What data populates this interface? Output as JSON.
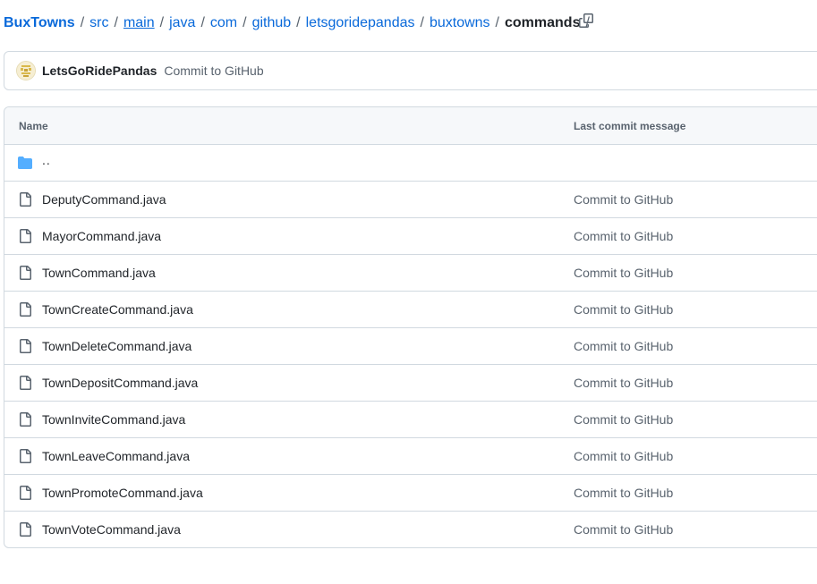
{
  "breadcrumb": {
    "repo": "BuxTowns",
    "path": [
      "src",
      "main",
      "java",
      "com",
      "github",
      "letsgoridepandas",
      "buxtowns"
    ],
    "current": "commands",
    "separator": "/",
    "copy_icon": "copy-icon"
  },
  "latest_commit": {
    "author": "LetsGoRidePandas",
    "message": "Commit to GitHub",
    "avatar_icon": "identicon-avatar"
  },
  "table": {
    "headers": {
      "name": "Name",
      "last_commit": "Last commit message"
    },
    "parent_link": "..",
    "rows": [
      {
        "name": "DeputyCommand.java",
        "message": "Commit to GitHub"
      },
      {
        "name": "MayorCommand.java",
        "message": "Commit to GitHub"
      },
      {
        "name": "TownCommand.java",
        "message": "Commit to GitHub"
      },
      {
        "name": "TownCreateCommand.java",
        "message": "Commit to GitHub"
      },
      {
        "name": "TownDeleteCommand.java",
        "message": "Commit to GitHub"
      },
      {
        "name": "TownDepositCommand.java",
        "message": "Commit to GitHub"
      },
      {
        "name": "TownInviteCommand.java",
        "message": "Commit to GitHub"
      },
      {
        "name": "TownLeaveCommand.java",
        "message": "Commit to GitHub"
      },
      {
        "name": "TownPromoteCommand.java",
        "message": "Commit to GitHub"
      },
      {
        "name": "TownVoteCommand.java",
        "message": "Commit to GitHub"
      }
    ]
  },
  "colors": {
    "link": "#0969da",
    "folder": "#54aeff",
    "muted": "#59636e",
    "border": "#d1d9e0"
  }
}
